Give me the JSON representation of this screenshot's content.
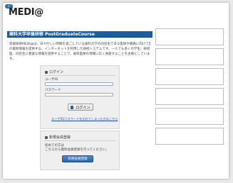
{
  "header": {
    "logo_text": "MEDI@",
    "logo_badge": "e"
  },
  "page": {
    "title": "歯科大学卒後研修 PostGraduateCourse"
  },
  "intro": {
    "lines": [
      "卒後研修MEDI@は、日々忙しい時間を過ごしている歯科大学の同窓生である医師や職員に向けて医療",
      "の最新情報を提供する、インターネットを利用した研修システムです。一人でも多くの学生、研修",
      "医、同窓生に豊富な情報を提供することで、歯科医療の現場に広く貢献することを主眼としていま",
      "す。"
    ]
  },
  "login": {
    "heading": "ログイン",
    "user_label": "ユーザID",
    "password_label": "パスワード",
    "user_value": "",
    "password_value": "",
    "button_label": "ログイン",
    "forgot_link": "ユーザID/パスワードを忘れてしまった方はこちら"
  },
  "register": {
    "heading": "新規会員登録",
    "line1": "初めての方は",
    "line2": "こちらから無料会員登録を行ってください。",
    "button_label": "新規会員登録"
  },
  "colors": {
    "accent": "#1a5f9e",
    "link": "#2457b3",
    "button_blue": "#2a64ab"
  },
  "sidebar": {
    "box_count": 6
  }
}
